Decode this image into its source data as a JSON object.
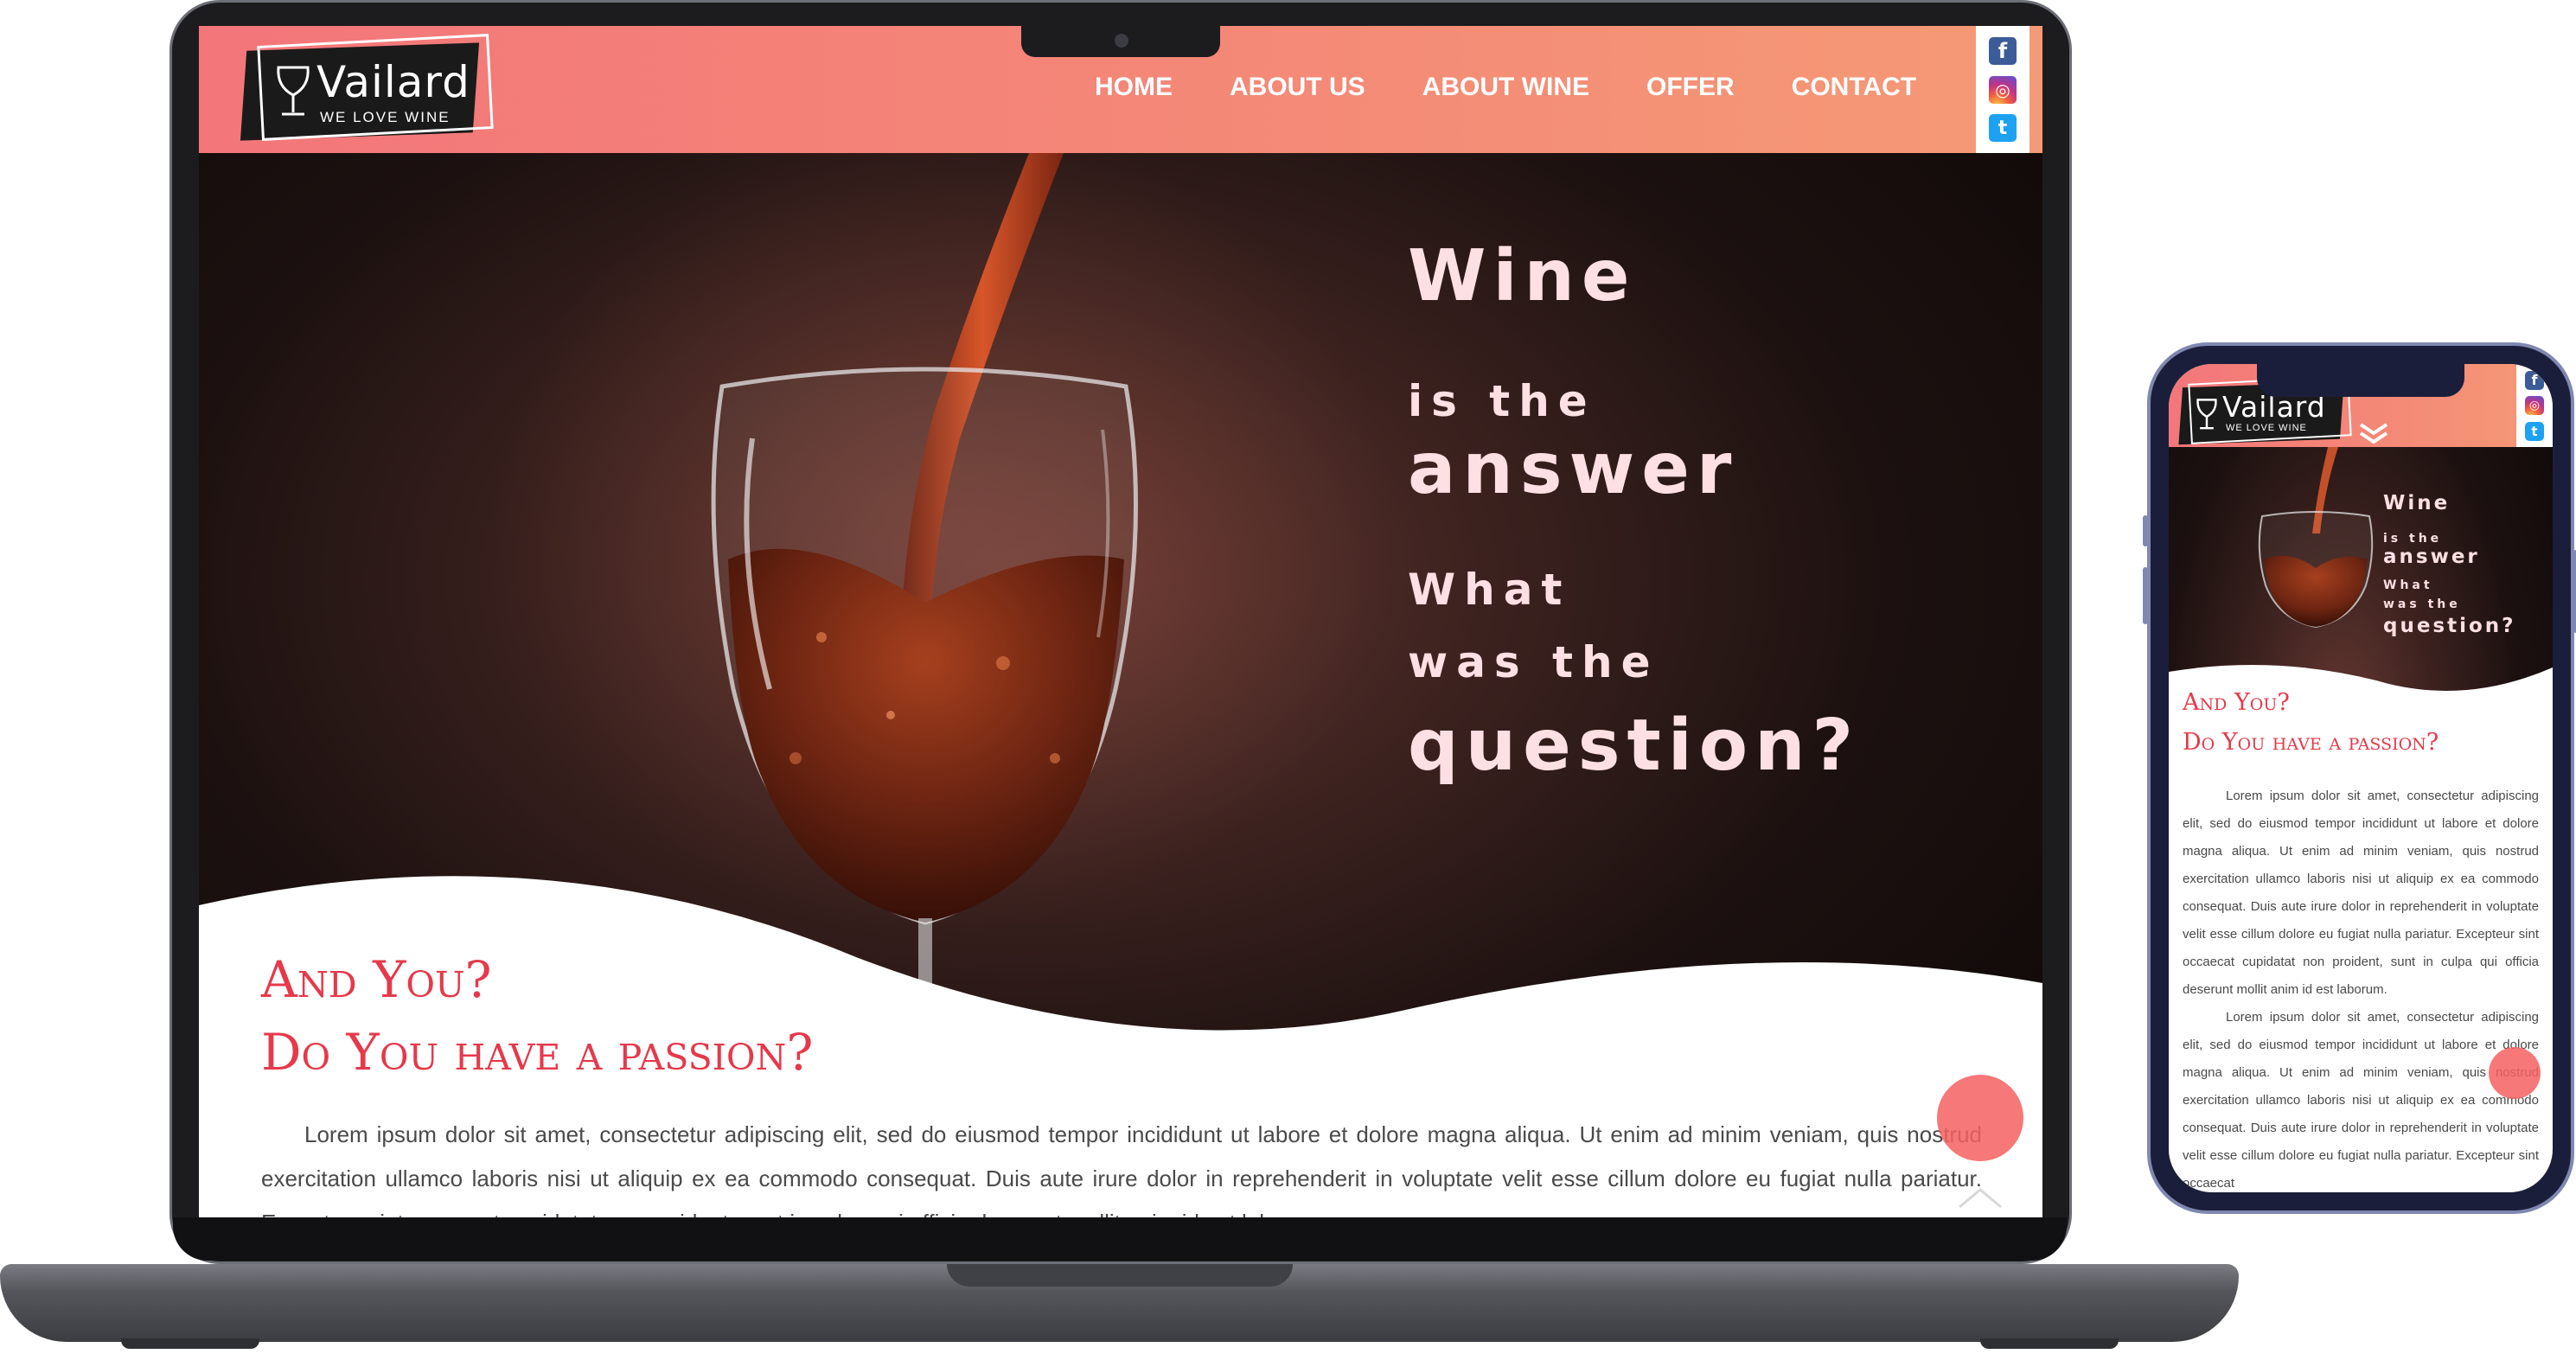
{
  "site": {
    "logo": {
      "name": "Vailard",
      "tagline": "WE LOVE WINE"
    },
    "nav": [
      {
        "label": "HOME"
      },
      {
        "label": "ABOUT US"
      },
      {
        "label": "ABOUT WINE"
      },
      {
        "label": "OFFER"
      },
      {
        "label": "CONTACT"
      }
    ],
    "social": [
      {
        "icon": "facebook-icon",
        "glyph": "f",
        "color": "#3b5c97"
      },
      {
        "icon": "instagram-icon",
        "glyph": "◎",
        "color": "#c13584"
      },
      {
        "icon": "twitter-icon",
        "glyph": "t",
        "color": "#1da1f2"
      }
    ],
    "hero": {
      "line1": "Wine",
      "line2": "is the",
      "line3": "answer",
      "line4": "What",
      "line5": "was the",
      "line6": "question?"
    },
    "section": {
      "title_line1": "And You?",
      "title_line2": "Do You have a passion?"
    },
    "lorem": "Lorem ipsum dolor sit amet, consectetur adipiscing elit, sed do eiusmod tempor incididunt ut labore et dolore magna aliqua. Ut enim ad minim veniam, quis nostrud exercitation ullamco laboris nisi ut aliquip ex ea commodo consequat. Duis aute irure dolor in reprehenderit in voluptate velit esse cillum dolore eu fugiat nulla pariatur. Excepteur sint occaecat cupidatat non proident, sunt in culpa qui officia deserunt mollit anim id est laborum.",
    "lorem_partial": "Lorem ipsum dolor sit amet, consectetur adipiscing elit, sed do eiusmod tempor incididunt ut labore et dolore magna aliqua. Ut enim ad minim veniam, quis nostrud exercitation ullamco laboris nisi ut aliquip ex ea commodo consequat. Duis aute irure dolor in reprehenderit in voluptate velit esse cillum dolore eu fugiat nulla pariatur. Excepteur sint occaecat"
  },
  "colors": {
    "header_start": "#f3767a",
    "header_end": "#f59a76",
    "accent": "#e6394a",
    "hero_text": "#fde0e3",
    "fab": "#f46060"
  }
}
